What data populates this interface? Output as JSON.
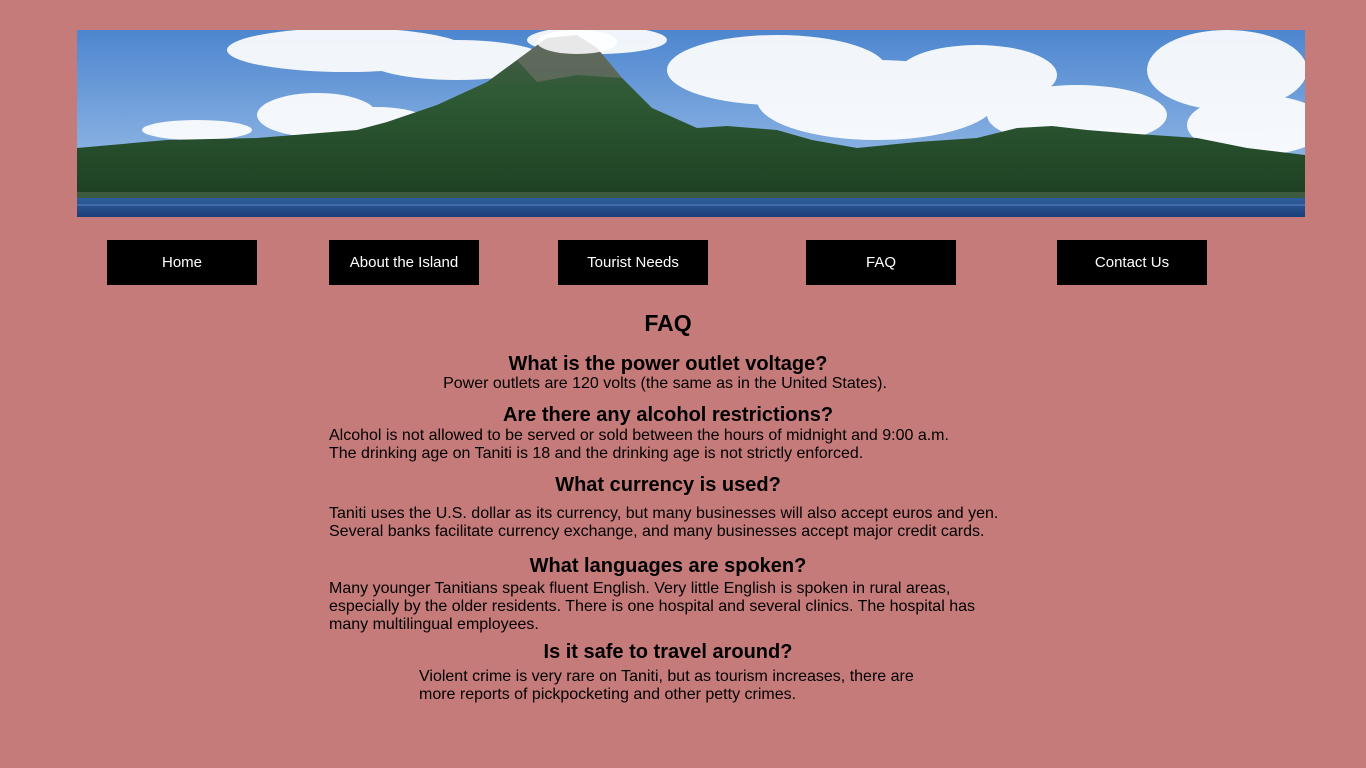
{
  "nav": {
    "items": [
      {
        "label": "Home"
      },
      {
        "label": "About the Island"
      },
      {
        "label": "Tourist Needs"
      },
      {
        "label": "FAQ"
      },
      {
        "label": "Contact Us"
      }
    ]
  },
  "page": {
    "title": "FAQ"
  },
  "faq": [
    {
      "question": "What is the power outlet voltage?",
      "lines": [
        "Power outlets are 120 volts (the same as in the United States)."
      ]
    },
    {
      "question": "Are there any alcohol restrictions?",
      "lines": [
        "Alcohol is not allowed to be served or sold between the hours of midnight and 9:00 a.m.",
        "The drinking age on Taniti is 18 and the drinking age is not strictly enforced."
      ]
    },
    {
      "question": "What currency is used?",
      "lines": [
        "Taniti uses the U.S. dollar as its currency, but many businesses will also accept euros and yen.",
        "Several banks facilitate currency exchange, and many businesses accept major credit cards."
      ]
    },
    {
      "question": "What languages are spoken?",
      "lines": [
        "Many younger Tanitians speak fluent English. Very little English is spoken in rural areas,",
        "especially by the older residents. There is one hospital and several clinics. The hospital has",
        "many multilingual employees."
      ]
    },
    {
      "question": "Is it safe to travel around?",
      "lines": [
        "Violent crime is very rare on Taniti, but as tourism increases, there are",
        "more reports of pickpocketing and other petty crimes."
      ]
    }
  ]
}
